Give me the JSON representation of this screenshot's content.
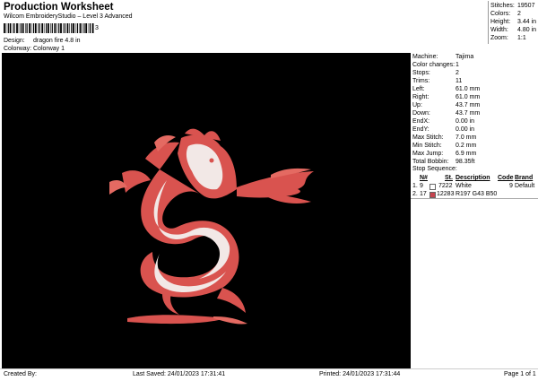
{
  "header": {
    "title": "Production Worksheet",
    "subtitle": "Wilcom EmbroideryStudio – Level 3 Advanced",
    "barcode_suffix": "3",
    "design_label": "Design:",
    "design_value": "dragon fire 4.8 in",
    "colorway_label": "Colorway:",
    "colorway_value": "Colorway 1"
  },
  "top_stats": [
    {
      "label": "Stitches:",
      "value": "19507"
    },
    {
      "label": "Colors:",
      "value": "2"
    },
    {
      "label": "Height:",
      "value": "3.44 in"
    },
    {
      "label": "Width:",
      "value": "4.80 in"
    },
    {
      "label": "Zoom:",
      "value": "1:1"
    }
  ],
  "machine_info": [
    {
      "label": "Machine:",
      "value": "Tajima"
    },
    {
      "label": "Color changes:",
      "value": "1"
    },
    {
      "label": "Stops:",
      "value": "2"
    },
    {
      "label": "Trims:",
      "value": "11"
    },
    {
      "label": "Left:",
      "value": "61.0 mm"
    },
    {
      "label": "Right:",
      "value": "61.0 mm"
    },
    {
      "label": "Up:",
      "value": "43.7 mm"
    },
    {
      "label": "Down:",
      "value": "43.7 mm"
    },
    {
      "label": "EndX:",
      "value": "0.00 in"
    },
    {
      "label": "EndY:",
      "value": "0.00 in"
    },
    {
      "label": "Max Stitch:",
      "value": "7.0 mm"
    },
    {
      "label": "Min Stitch:",
      "value": "0.2 mm"
    },
    {
      "label": "Max Jump:",
      "value": "6.9 mm"
    },
    {
      "label": "Total Bobbin:",
      "value": "98.35ft"
    }
  ],
  "stop_sequence": {
    "title": "Stop Sequence:",
    "headers": {
      "n": "N#",
      "st": "St.",
      "description": "Description",
      "code": "Code",
      "brand": "Brand"
    },
    "rows": [
      {
        "index": "1.",
        "n": "9",
        "color": "#ffffff",
        "st": "7222",
        "description": "White",
        "code": "9",
        "brand": "Default"
      },
      {
        "index": "2.",
        "n": "17",
        "color": "#c5434e",
        "st": "12283",
        "description": "R197 G43 B50",
        "code": "",
        "brand": ""
      }
    ]
  },
  "footer": {
    "created_by": "Created By:",
    "last_saved": "Last Saved: 24/01/2023 17:31:41",
    "printed": "Printed: 24/01/2023 17:31:44",
    "page": "Page 1 of 1"
  },
  "design_colors": {
    "background": "#000000",
    "outline": "#d9534f",
    "fill": "#f2e8e6"
  }
}
